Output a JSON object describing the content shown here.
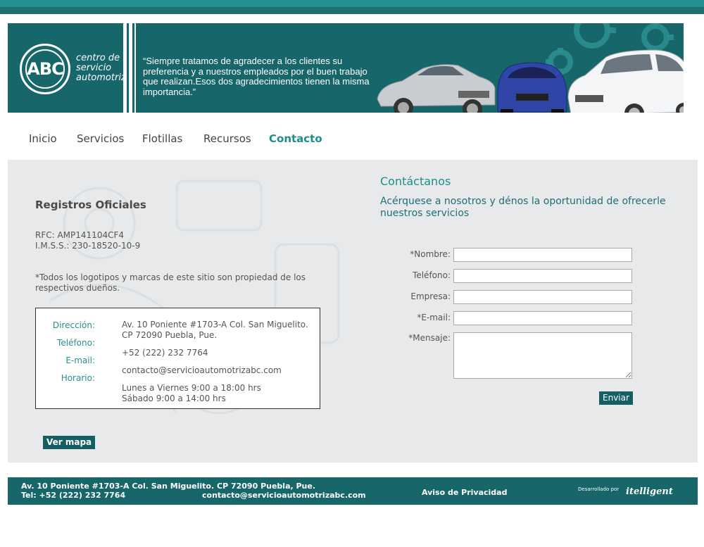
{
  "site": {
    "logo_mark": "ABC",
    "logo_text": [
      "centro de",
      "servicio",
      "automotriz"
    ],
    "quote": "“Siempre tratamos de agradecer a los clientes su preferencia y a nuestros empleados por el buen trabajo que realizan.Esos dos agradecimientos tienen la misma importancia.”"
  },
  "nav": {
    "items": [
      {
        "label": "Inicio"
      },
      {
        "label": "Servicios"
      },
      {
        "label": "Flotillas"
      },
      {
        "label": "Recursos"
      },
      {
        "label": "Contacto",
        "active": true
      }
    ]
  },
  "registros": {
    "title": "Registros Oficiales",
    "rfc": "RFC: AMP141104CF4",
    "imss": "I.M.S.S.: 230-18520-10-9",
    "note": "*Todos los logotipos y marcas de este sitio son propiedad de los respectivos dueños."
  },
  "info": {
    "direccion_label": "Dirección:",
    "telefono_label": "Teléfono:",
    "email_label": "E-mail:",
    "horario_label": "Horario:",
    "direccion_1": "Av. 10 Poniente #1703-A Col. San Miguelito.",
    "direccion_2": "CP 72090 Puebla, Pue.",
    "telefono": "+52 (222) 232 7764",
    "email": "contacto@servicioautomotrizabc.com",
    "horario_1": "Lunes a Viernes 9:00 a 18:00 hrs",
    "horario_2": "Sábado 9:00 a 14:00 hrs"
  },
  "ver_mapa": "Ver mapa",
  "contact": {
    "title": "Contáctanos",
    "subtitle": "Acérquese a nosotros y dénos la oportunidad de ofrecerle nuestros servicios",
    "fields": {
      "nombre": "*Nombre:",
      "telefono": "Teléfono:",
      "empresa": "Empresa:",
      "email": "*E-mail:",
      "mensaje": "*Mensaje:"
    },
    "submit": "Enviar"
  },
  "footer": {
    "address": "Av. 10 Poniente #1703-A Col. San Miguelito. CP 72090 Puebla, Pue.",
    "phone": "Tel: +52 (222) 232 7764",
    "email": "contacto@servicioautomotrizabc.com",
    "privacy": "Aviso de Privacidad",
    "developed_by": "Desarrollado por",
    "developer": "itelligent"
  },
  "colors": {
    "brand_teal": "#16666a",
    "accent": "#1d8e8b",
    "button": "#155f64"
  }
}
